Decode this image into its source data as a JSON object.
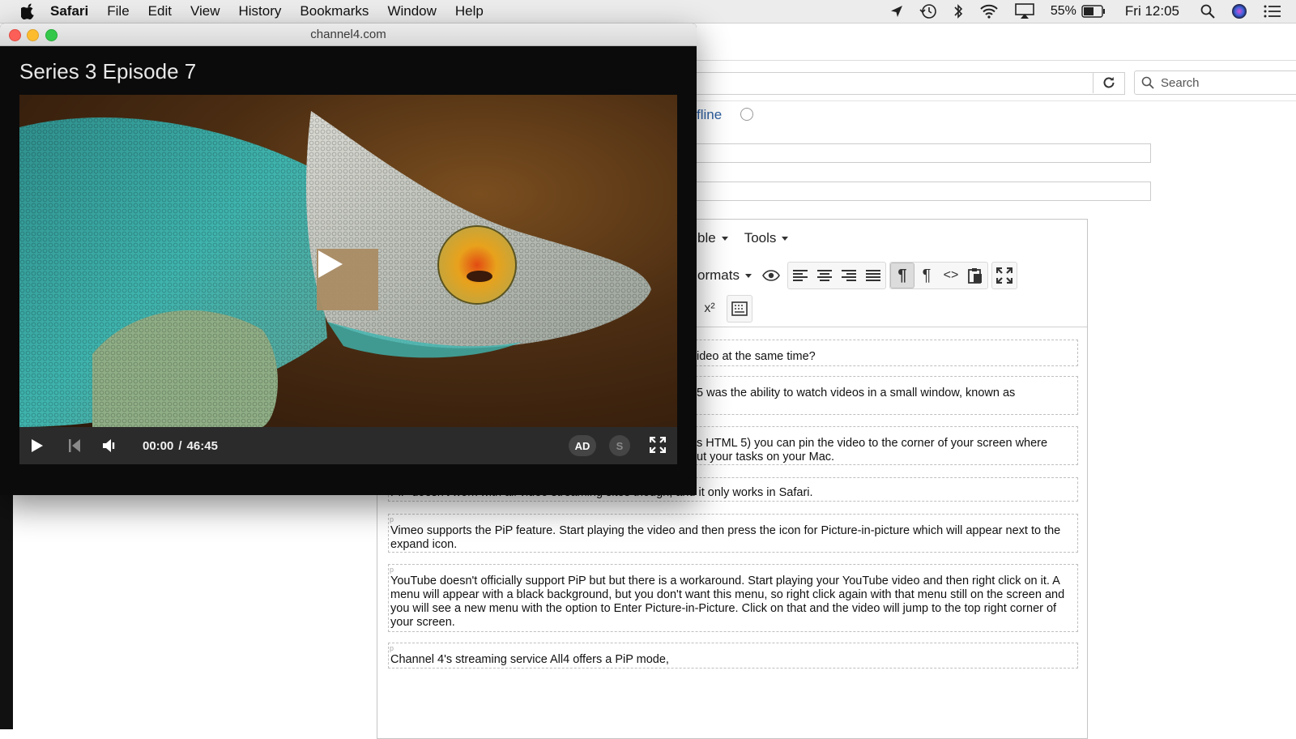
{
  "menubar": {
    "app_name": "Safari",
    "items": [
      "File",
      "Edit",
      "View",
      "History",
      "Bookmarks",
      "Window",
      "Help"
    ],
    "battery_percent": "55%",
    "clock": "Fri 12:05"
  },
  "browser": {
    "search_placeholder": "Search"
  },
  "page": {
    "offline_label": "fline",
    "editor": {
      "menu": [
        "ble",
        "Tools"
      ],
      "formats_label": "ormats",
      "paragraphs": [
        {
          "text": "ideo at the same time?"
        },
        {
          "text": "5 was the ability to watch videos in a small window, known as"
        },
        {
          "text": "s HTML 5) you can pin the video to the corner of your screen where\nut your tasks on your Mac."
        },
        {
          "text": "PiP doesn't work with all video streaming sites though, and it only works in Safari."
        },
        {
          "text": "Vimeo supports the PiP feature. Start playing the video and then press the icon for Picture-in-picture which will appear next to the expand icon."
        },
        {
          "text": "YouTube doesn't officially support PiP but but there is a workaround. Start playing your YouTube video and then right click on it. A menu will appear with a black background, but you don't want this menu, so right click again with that menu still on the screen and you will see a new menu with the option to Enter Picture-in-Picture. Click on that and the video will jump to the top right corner of your screen."
        },
        {
          "text": "Channel 4's streaming service All4 offers a PiP mode,"
        }
      ]
    }
  },
  "pip": {
    "window_title": "channel4.com",
    "episode_title": "Series 3 Episode 7",
    "time_current": "00:00",
    "time_separator": "/",
    "time_total": "46:45",
    "ad_label": "AD",
    "subtitles_label": "S"
  },
  "colors": {
    "link_blue": "#2a5d9f",
    "play_overlay": "#aa8c64",
    "controls_bar": "#2b2b2b"
  },
  "icons": [
    "apple-icon",
    "location-icon",
    "time-machine-icon",
    "bluetooth-icon",
    "wifi-icon",
    "airplay-icon",
    "battery-icon",
    "spotlight-icon",
    "siri-icon",
    "notification-center-icon",
    "reload-icon",
    "search-icon",
    "play-icon",
    "skip-back-icon",
    "volume-icon",
    "fullscreen-icon",
    "eye-icon"
  ]
}
